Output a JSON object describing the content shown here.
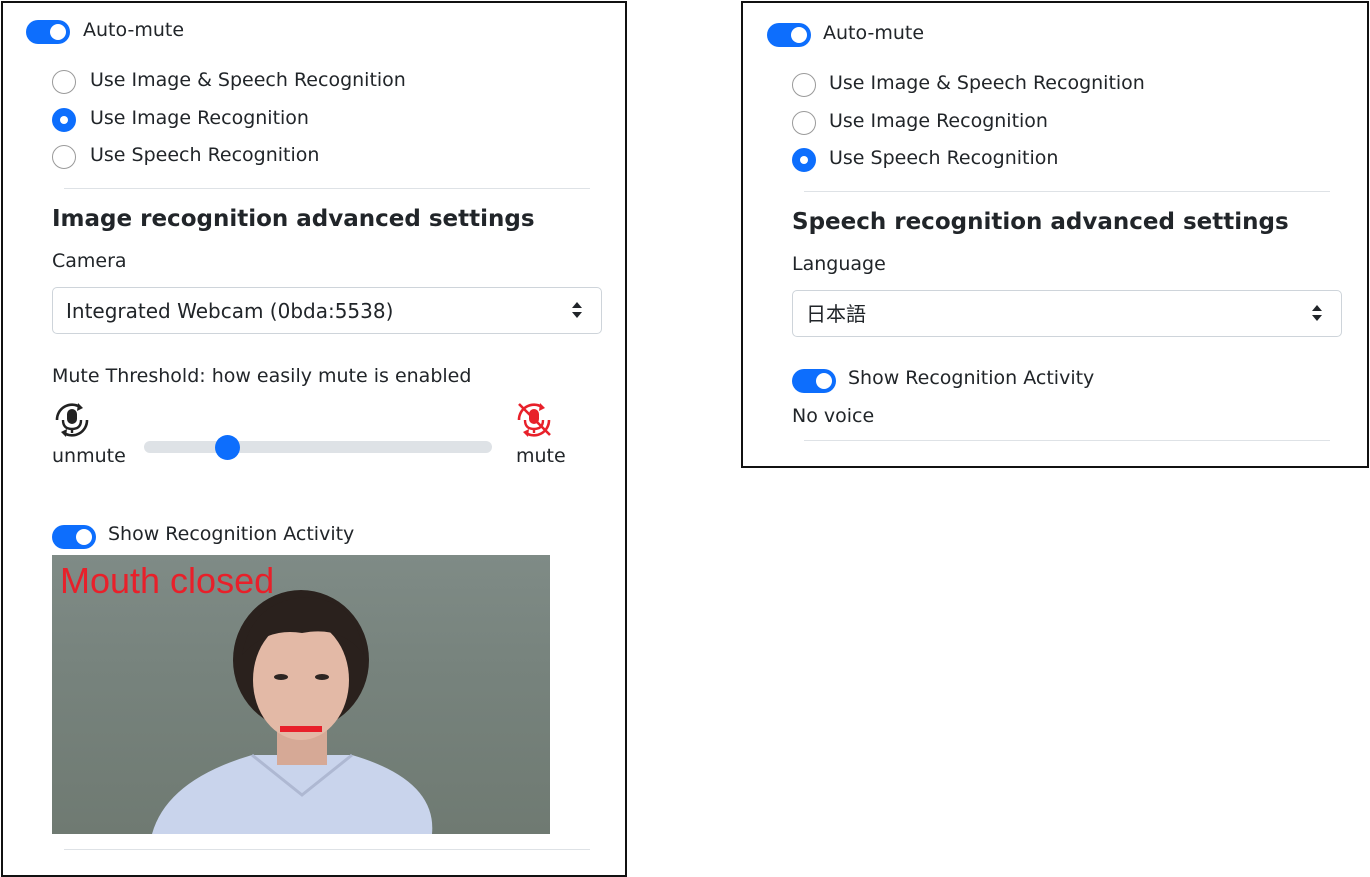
{
  "left_panel": {
    "auto_mute": {
      "label": "Auto-mute",
      "checked": true
    },
    "mode_options": [
      {
        "label": "Use Image & Speech Recognition",
        "checked": false
      },
      {
        "label": "Use Image Recognition",
        "checked": true
      },
      {
        "label": "Use Speech Recognition",
        "checked": false
      }
    ],
    "section_title": "Image recognition advanced settings",
    "camera": {
      "label": "Camera",
      "selected": "Integrated Webcam (0bda:5538)"
    },
    "threshold": {
      "label": "Mute Threshold: how easily mute is enabled",
      "min_label": "unmute",
      "max_label": "mute",
      "value_fraction": 0.24
    },
    "show_activity": {
      "label": "Show Recognition Activity",
      "checked": true
    },
    "camera_preview": {
      "overlay_text": "Mouth closed"
    }
  },
  "right_panel": {
    "auto_mute": {
      "label": "Auto-mute",
      "checked": true
    },
    "mode_options": [
      {
        "label": "Use Image & Speech Recognition",
        "checked": false
      },
      {
        "label": "Use Image Recognition",
        "checked": false
      },
      {
        "label": "Use Speech Recognition",
        "checked": true
      }
    ],
    "section_title": "Speech recognition advanced settings",
    "language": {
      "label": "Language",
      "selected": "日本語"
    },
    "show_activity": {
      "label": "Show Recognition Activity",
      "checked": true
    },
    "status_text": "No voice"
  },
  "colors": {
    "accent": "#0d6efd",
    "mute_icon": "#e8202a",
    "overlay_text": "#e8202a"
  },
  "icons": {
    "unmute": "mic-rotate-icon",
    "mute": "mic-muted-icon",
    "select_caret": "sort-caret-icon"
  }
}
